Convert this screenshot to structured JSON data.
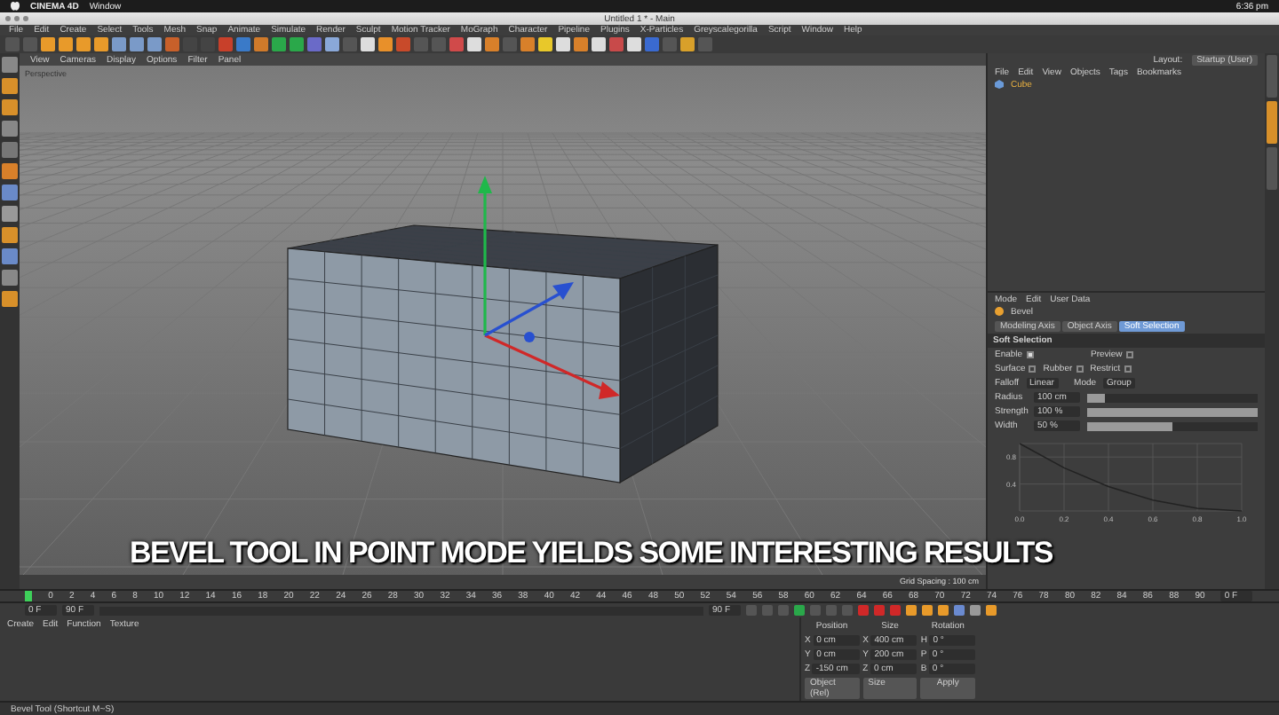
{
  "os_menubar": {
    "app": "CINEMA 4D",
    "menu": "Window",
    "clock": "6:36 pm"
  },
  "window": {
    "title": "Untitled 1 * - Main"
  },
  "menu": [
    "File",
    "Edit",
    "Create",
    "Select",
    "Tools",
    "Mesh",
    "Snap",
    "Animate",
    "Simulate",
    "Render",
    "Sculpt",
    "Motion Tracker",
    "MoGraph",
    "Character",
    "Pipeline",
    "Plugins",
    "X-Particles",
    "Greyscalegorilla",
    "Script",
    "Window",
    "Help"
  ],
  "viewport": {
    "menu": [
      "View",
      "Cameras",
      "Display",
      "Options",
      "Filter",
      "Panel"
    ],
    "camera": "Perspective",
    "grid_spacing": "Grid Spacing : 100 cm",
    "caption": "BEVEL TOOL IN POINT MODE YIELDS SOME INTERESTING RESULTS"
  },
  "layout": {
    "label": "Layout:",
    "value": "Startup (User)"
  },
  "object_manager": {
    "menu": [
      "File",
      "Edit",
      "View",
      "Objects",
      "Tags",
      "Bookmarks"
    ],
    "objects": [
      {
        "name": "Cube",
        "selected": false
      }
    ]
  },
  "attributes": {
    "menu": [
      "Mode",
      "Edit",
      "User Data"
    ],
    "tool": "Bevel",
    "tabs": [
      {
        "label": "Modeling Axis",
        "selected": false
      },
      {
        "label": "Object Axis",
        "selected": false
      },
      {
        "label": "Soft Selection",
        "selected": true
      }
    ],
    "section": "Soft Selection",
    "checks": [
      {
        "label": "Enable",
        "checked": true
      },
      {
        "label": "Preview",
        "checked": false
      },
      {
        "label": "Surface",
        "checked": false
      },
      {
        "label": "Rubber",
        "checked": false
      },
      {
        "label": "Restrict",
        "checked": false
      }
    ],
    "falloff": {
      "label": "Falloff",
      "value": "Linear"
    },
    "mode": {
      "label": "Mode",
      "value": "Group"
    },
    "sliders": [
      {
        "label": "Radius",
        "reading": "100 cm",
        "level": 0.1
      },
      {
        "label": "Strength",
        "reading": "100 %",
        "level": 1
      },
      {
        "label": "Width",
        "reading": "50 %",
        "level": 0.5
      }
    ],
    "chart_data": {
      "type": "line",
      "x": [
        0,
        0.2,
        0.4,
        0.6,
        0.8,
        1
      ],
      "values": [
        1,
        0.64,
        0.36,
        0.16,
        0.04,
        0
      ],
      "xticks": [
        {
          "value": 0,
          "label": "0.0"
        },
        {
          "value": 0.2,
          "label": "0.2"
        },
        {
          "value": 0.4,
          "label": "0.4"
        },
        {
          "value": 0.6,
          "label": "0.6"
        },
        {
          "value": 0.8,
          "label": "0.8"
        },
        {
          "value": 1,
          "label": "1.0"
        }
      ],
      "yticks": [
        {
          "value": 0.8,
          "label": "0.8"
        },
        {
          "value": 0.4,
          "label": "0.4"
        }
      ],
      "xlim": [
        0,
        1
      ],
      "ylim": [
        0,
        1
      ],
      "grid": true
    }
  },
  "side_tabs": [
    {
      "selected": false
    },
    {
      "selected": true
    },
    {
      "selected": false
    }
  ],
  "timeline": {
    "ticks": [
      "0",
      "2",
      "4",
      "6",
      "8",
      "10",
      "12",
      "14",
      "16",
      "18",
      "20",
      "22",
      "24",
      "26",
      "28",
      "30",
      "32",
      "34",
      "36",
      "38",
      "40",
      "42",
      "44",
      "46",
      "48",
      "50",
      "52",
      "54",
      "56",
      "58",
      "60",
      "62",
      "64",
      "66",
      "68",
      "70",
      "72",
      "74",
      "76",
      "78",
      "80",
      "82",
      "84",
      "86",
      "88",
      "90"
    ],
    "end_label": "0 F",
    "fields": [
      "0 F",
      "90 F"
    ],
    "right_field": "90 F"
  },
  "materials": {
    "menu": [
      "Create",
      "Edit",
      "Function",
      "Texture"
    ]
  },
  "coordinates": {
    "headers": [
      "Position",
      "Size",
      "Rotation"
    ],
    "rows": [
      {
        "axis": "X",
        "position": "0 cm",
        "size_axis": "X",
        "size": "400 cm",
        "rot_axis": "H",
        "rotation": "0 °"
      },
      {
        "axis": "Y",
        "position": "0 cm",
        "size_axis": "Y",
        "size": "200 cm",
        "rot_axis": "P",
        "rotation": "0 °"
      },
      {
        "axis": "Z",
        "position": "-150 cm",
        "size_axis": "Z",
        "size": "0 cm",
        "rot_axis": "B",
        "rotation": "0 °"
      }
    ],
    "mode": "Object (Rel)",
    "size_mode": "Size",
    "apply": "Apply"
  },
  "status_bar": "Bevel Tool (Shortcut M~S)"
}
